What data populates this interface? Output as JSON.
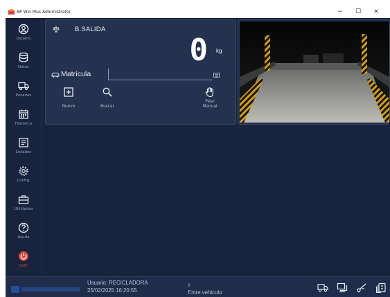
{
  "window": {
    "title": "BP Win Plus Administrator",
    "minimize_label": "−",
    "maximize_label": "☐",
    "close_label": "×"
  },
  "sidebar": {
    "items": [
      {
        "label": "Usuario",
        "icon": "user-circle-icon"
      },
      {
        "label": "Datos",
        "icon": "database-icon"
      },
      {
        "label": "Pesadas",
        "icon": "truck-icon"
      },
      {
        "label": "Histórico",
        "icon": "calendar-icon"
      },
      {
        "label": "Listados",
        "icon": "list-icon"
      },
      {
        "label": "Config.",
        "icon": "gear-icon"
      },
      {
        "label": "Utilidades",
        "icon": "toolbox-icon"
      },
      {
        "label": "Ayuda",
        "icon": "help-icon"
      },
      {
        "label": "Salir",
        "icon": "power-icon"
      }
    ]
  },
  "scale": {
    "name": "B.SALIDA",
    "weight": "0",
    "unit": "kg",
    "plate_label": "Matrícula",
    "plate_value": ""
  },
  "actions": {
    "new_label": "Nuevo",
    "search_label": "Buscar",
    "manual_label_1": "Peso",
    "manual_label_2": "Manual"
  },
  "status": {
    "user": "Usuario: RECICLADORA",
    "datetime": "25/02/2025 16:20:55",
    "count": "0",
    "message": "Entre vehiculo"
  },
  "colors": {
    "background": "#18233e",
    "panel": "#25324f",
    "exit_accent": "#d9443f",
    "text": "#e9edf5"
  }
}
